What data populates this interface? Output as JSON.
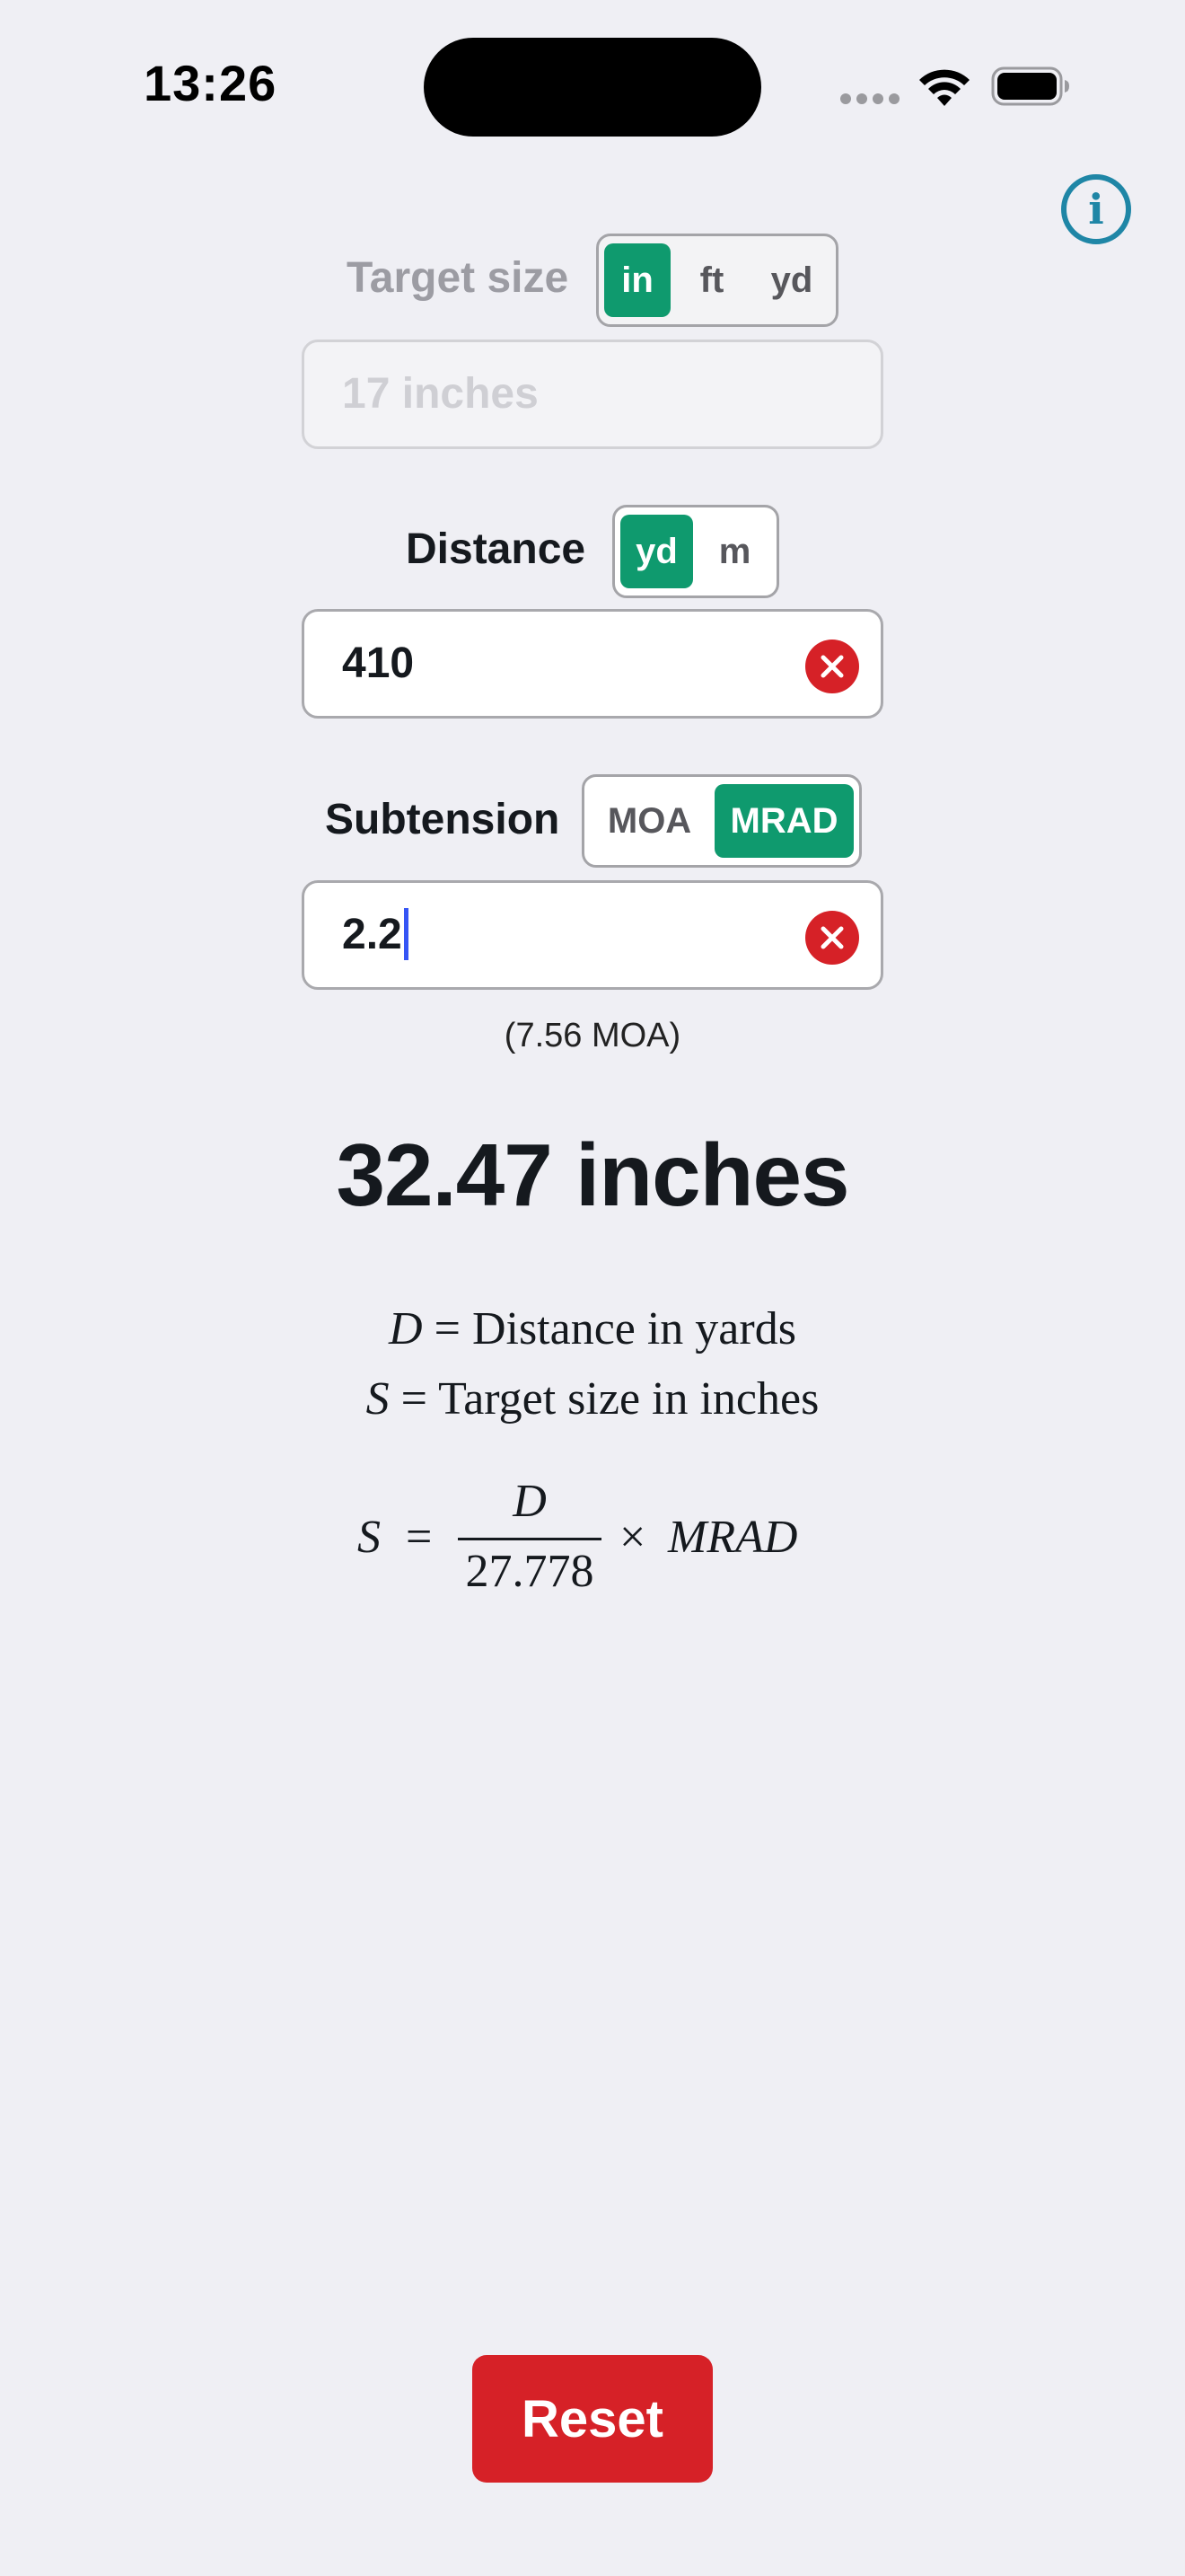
{
  "status_bar": {
    "time": "13:26"
  },
  "target_size": {
    "label": "Target size",
    "units": [
      "in",
      "ft",
      "yd"
    ],
    "selected_unit": "in",
    "placeholder": "17 inches"
  },
  "distance": {
    "label": "Distance",
    "units": [
      "yd",
      "m"
    ],
    "selected_unit": "yd",
    "value": "410"
  },
  "subtension": {
    "label": "Subtension",
    "units": [
      "MOA",
      "MRAD"
    ],
    "selected_unit": "MRAD",
    "value": "2.2",
    "conversion_note": "(7.56 MOA)"
  },
  "result": "32.47 inches",
  "formula": {
    "d_symbol": "D",
    "d_definition": "Distance in yards",
    "s_symbol": "S",
    "s_definition": "Target size in inches",
    "equals": "=",
    "numerator": "D",
    "denominator": "27.778",
    "times": "×",
    "unit_term": "MRAD"
  },
  "info_glyph": "i",
  "reset_label": "Reset",
  "colors": {
    "accent": "#0f9a6e",
    "danger": "#d62127",
    "info": "#1f86a6",
    "background": "#efeff4"
  }
}
